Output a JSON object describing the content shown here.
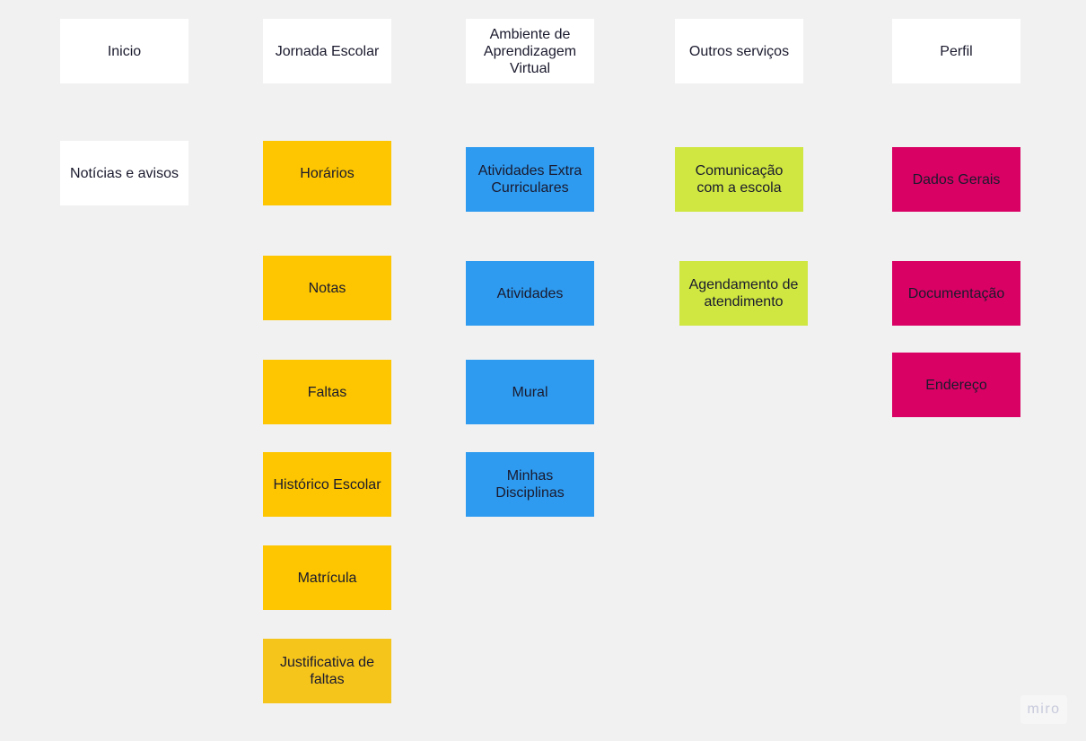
{
  "board": {
    "background": "#f1f1f1",
    "watermark": "miro"
  },
  "colors": {
    "header": "#ffffff",
    "jornada": "#fdc600",
    "ambiente": "#2e9bf0",
    "outros": "#cfe740",
    "perfil": "#d90264"
  },
  "headers": {
    "inicio": "Inicio",
    "jornada": "Jornada Escolar",
    "ambiente": "Ambiente de Aprendizagem Virtual",
    "outros": "Outros serviços",
    "perfil": "Perfil"
  },
  "inicio_items": [
    "Notícias e avisos"
  ],
  "jornada_items": [
    "Horários",
    "Notas",
    "Faltas",
    "Histórico Escolar",
    "Matrícula",
    "Justificativa de faltas"
  ],
  "ambiente_items": [
    "Atividades Extra Curriculares",
    "Atividades",
    "Mural",
    "Minhas Disciplinas"
  ],
  "outros_items": [
    "Comunicação com a escola",
    "Agendamento de atendimento"
  ],
  "perfil_items": [
    "Dados Gerais",
    "Documentação",
    "Endereço"
  ]
}
